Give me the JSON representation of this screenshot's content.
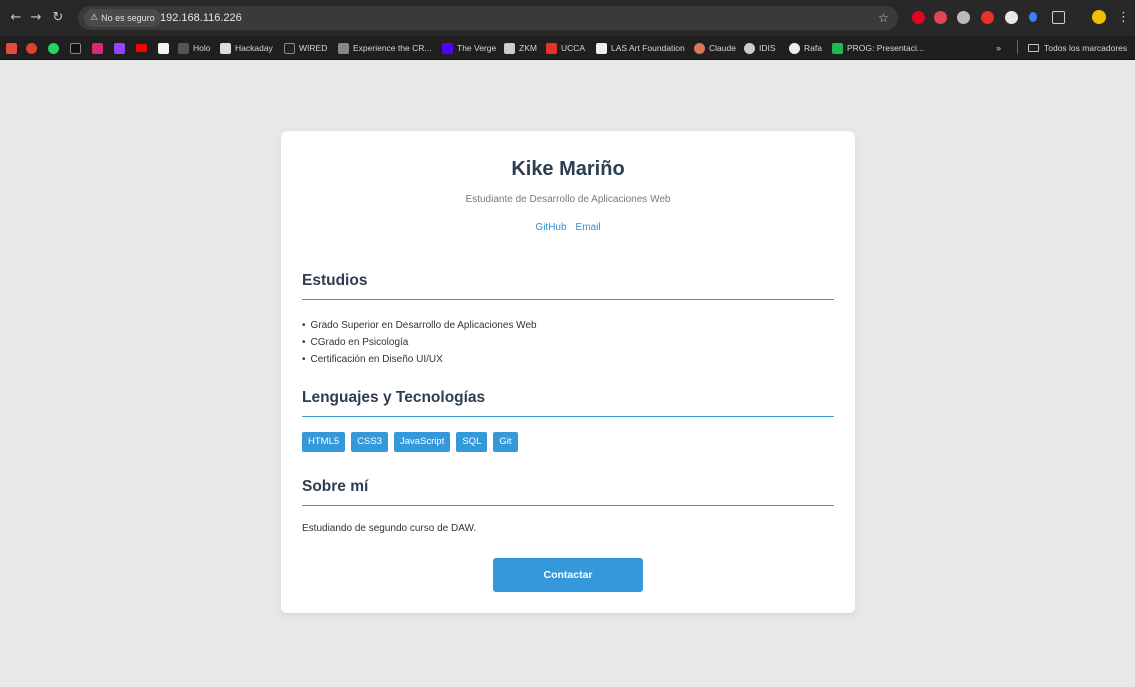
{
  "browser": {
    "security_label": "No es seguro",
    "url": "192.168.116.226",
    "bookmarks": [
      {
        "label": "",
        "color": "#e44b3d"
      },
      {
        "label": "",
        "color": "#d9432f"
      },
      {
        "label": "",
        "color": "#25d366"
      },
      {
        "label": "",
        "color": "#111111"
      },
      {
        "label": "",
        "color": "#d62976"
      },
      {
        "label": "",
        "color": "#9146ff"
      },
      {
        "label": "",
        "color": "#ff0000"
      },
      {
        "label": "",
        "color": "#f2f2f2"
      },
      {
        "label": "Holo",
        "color": "#555555"
      },
      {
        "label": "Hackaday",
        "color": "#dddddd"
      },
      {
        "label": "WIRED",
        "color": "#222222"
      },
      {
        "label": "Experience the CR...",
        "color": "#888888"
      },
      {
        "label": "The Verge",
        "color": "#5200ff"
      },
      {
        "label": "ZKM",
        "color": "#cccccc"
      },
      {
        "label": "UCCA",
        "color": "#e5332a"
      },
      {
        "label": "LAS Art Foundation",
        "color": "#eeeeee"
      },
      {
        "label": "Claude",
        "color": "#d97757"
      },
      {
        "label": "IDIS",
        "color": "#cccccc"
      },
      {
        "label": "Rafa",
        "color": "#eeeeee"
      },
      {
        "label": "PROG: Presentaci...",
        "color": "#1db954"
      }
    ],
    "all_bookmarks_label": "Todos los marcadores",
    "more_bookmarks": "»"
  },
  "profile": {
    "name": "Kike Mariño",
    "subtitle": "Estudiante de Desarrollo de Aplicaciones Web",
    "links": [
      "GitHub",
      "Email"
    ]
  },
  "education": {
    "title": "Estudios",
    "items": [
      "Grado Superior en Desarrollo de Aplicaciones Web",
      "CGrado en Psicología",
      "Certificación en Diseño UI/UX"
    ]
  },
  "skills": {
    "title": "Lenguajes y Tecnologías",
    "tags": [
      "HTML5",
      "CSS3",
      "JavaScript",
      "SQL",
      "Git"
    ]
  },
  "about": {
    "title": "Sobre mí",
    "text": "Estudiando de segundo curso de DAW."
  },
  "contact_label": "Contactar",
  "colors": {
    "accent": "#3498db",
    "heading": "#2c3e50",
    "link": "#2d8fd5",
    "background": "#e8e8e8"
  }
}
